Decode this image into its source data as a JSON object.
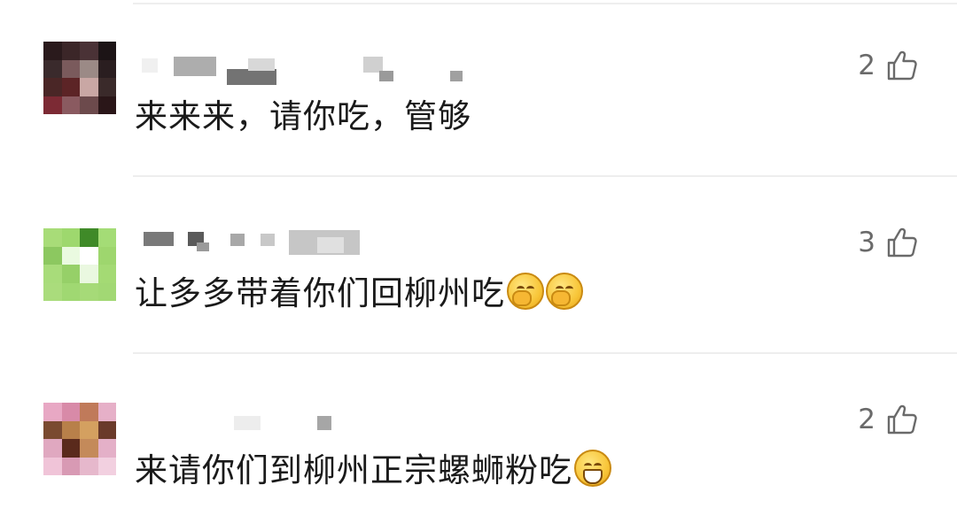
{
  "comments": [
    {
      "text": "来来来，请你吃，管够",
      "emojis": [],
      "likes": "2",
      "avatar_colors": [
        "#2a1a1c",
        "#3b2628",
        "#4a3236",
        "#1c1416",
        "#3a2a2c",
        "#7a5a5c",
        "#9b8a86",
        "#2a1e20",
        "#4a2626",
        "#5c2426",
        "#c9a7a4",
        "#3a2a2a",
        "#7c2a34",
        "#8a5a60",
        "#6c4a4c",
        "#2a1618"
      ]
    },
    {
      "text": "让多多带着你们回柳州吃",
      "emojis": [
        "thinking-emoji",
        "thinking-emoji"
      ],
      "likes": "3",
      "avatar_colors": [
        "#a8dc78",
        "#9ed86e",
        "#3f8a28",
        "#a4dc76",
        "#8cc860",
        "#eafae0",
        "#ffffff",
        "#9ed66e",
        "#a8dc7a",
        "#96d068",
        "#eaf8e0",
        "#a4da74",
        "#aadc7c",
        "#a0d872",
        "#a6da78",
        "#a2d874"
      ]
    },
    {
      "text": "来请你们到柳州正宗螺蛳粉吃",
      "emojis": [
        "grinning-emoji"
      ],
      "likes": "2",
      "avatar_colors": [
        "#e8a8c4",
        "#d88aa8",
        "#c07a5a",
        "#e6b0c8",
        "#7a4a30",
        "#b8804a",
        "#d4a060",
        "#6a3a2a",
        "#e0a8c0",
        "#5a2a1c",
        "#c48a5a",
        "#e4b0c8",
        "#f0c4d8",
        "#d89ab4",
        "#e6b8cc",
        "#f2d0e0"
      ]
    }
  ]
}
